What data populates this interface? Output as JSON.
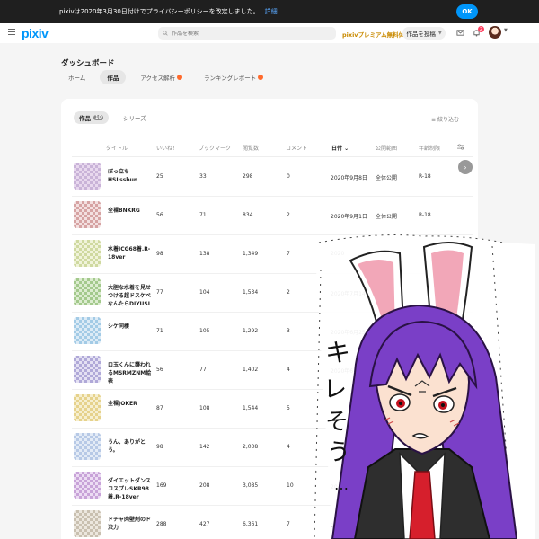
{
  "notice": {
    "text": "pixivは2020年3月30日付けでプライバシーポリシーを改定しました。",
    "detail": "詳細",
    "ok": "OK"
  },
  "header": {
    "logo": "pixiv",
    "search_placeholder": "作品を検索",
    "premium": "pixivプレミアム無料体験",
    "post_button": "作品を投稿",
    "notification_count": "2"
  },
  "dashboard": {
    "title": "ダッシュボード",
    "tabs": [
      "ホーム",
      "作品",
      "アクセス解析",
      "ランキングレポート"
    ],
    "subtabs": [
      "作品",
      "シリーズ"
    ],
    "works_count": "10",
    "filter": "絞り込む"
  },
  "table": {
    "headers": [
      "タイトル",
      "いいね！",
      "ブックマーク",
      "閲覧数",
      "コメント",
      "日付",
      "公開範囲",
      "年齢制限"
    ],
    "rows": [
      {
        "title": "ぼっ立ち HSLssbun",
        "likes": "25",
        "bookmarks": "33",
        "views": "298",
        "comments": "0",
        "date": "2020年9月8日",
        "visibility": "全体公開",
        "age": "R-18"
      },
      {
        "title": "全裸BNKRG",
        "likes": "56",
        "bookmarks": "71",
        "views": "834",
        "comments": "2",
        "date": "2020年9月1日",
        "visibility": "全体公開",
        "age": "R-18"
      },
      {
        "title": "水着ICG68着.R-18ver",
        "likes": "98",
        "bookmarks": "138",
        "views": "1,349",
        "comments": "7",
        "date": "2020",
        "visibility": "",
        "age": ""
      },
      {
        "title": "大胆な水着を見せつける超ドスケベなんたらDIYUSI",
        "likes": "77",
        "bookmarks": "104",
        "views": "1,534",
        "comments": "2",
        "date": "2020年7月14日",
        "visibility": "全体",
        "age": ""
      },
      {
        "title": "シケ同棲",
        "likes": "71",
        "bookmarks": "105",
        "views": "1,292",
        "comments": "3",
        "date": "2020年6月25日",
        "visibility": "",
        "age": ""
      },
      {
        "title": "ロ玉くんに襲われるMSRMZNM絵表",
        "likes": "56",
        "bookmarks": "77",
        "views": "1,402",
        "comments": "4",
        "date": "2020年6月",
        "visibility": "",
        "age": ""
      },
      {
        "title": "全裸JOKER",
        "likes": "87",
        "bookmarks": "108",
        "views": "1,544",
        "comments": "5",
        "date": "",
        "visibility": "",
        "age": ""
      },
      {
        "title": "うん、ありがとう。",
        "likes": "98",
        "bookmarks": "142",
        "views": "2,038",
        "comments": "4",
        "date": "2020年4月21",
        "visibility": "",
        "age": ""
      },
      {
        "title": "ダイエットダンスコスプレSKR98着.R-18ver",
        "likes": "169",
        "bookmarks": "208",
        "views": "3,085",
        "comments": "10",
        "date": "2019年",
        "visibility": "",
        "age": ""
      },
      {
        "title": "ドチャ肉壁剤のド渋力",
        "likes": "288",
        "bookmarks": "427",
        "views": "6,361",
        "comments": "7",
        "date": "2019年",
        "visibility": "",
        "age": ""
      }
    ]
  },
  "overlay": {
    "speech": "キレそう…"
  },
  "colors": {
    "accent": "#0096fa",
    "notice_bg": "#1f1f1f",
    "premium": "#c98a00",
    "hair": "#7a3fc7"
  }
}
